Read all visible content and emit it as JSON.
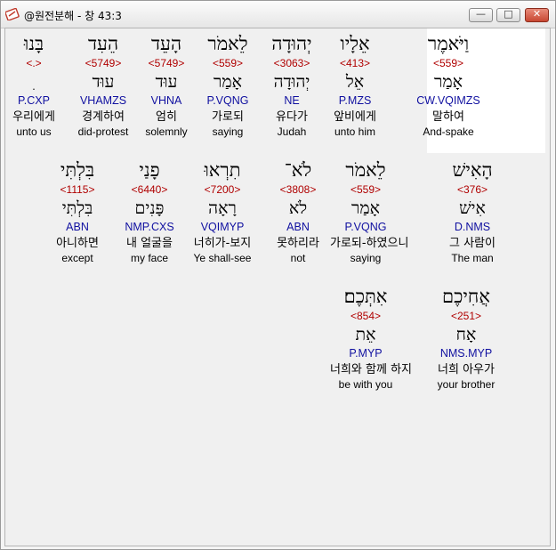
{
  "window": {
    "title": "@원전분해 - 창 43:3",
    "buttons": {
      "minimize": "—",
      "maximize": "□",
      "close": "✕"
    }
  },
  "rows": [
    {
      "words": [
        {
          "hebrew": "וַיֹּאמֶר",
          "strong": "<559>",
          "root": "אָמַר",
          "morph": "CW.VQIMZS",
          "korean": "말하여",
          "english": "And-spake",
          "highlighted": true
        },
        {
          "hebrew": "אֵלָיו",
          "strong": "<413>",
          "root": "אֵל",
          "morph": "P.MZS",
          "korean": "앞비에게",
          "english": "unto him"
        },
        {
          "hebrew": "יְהוּדָה",
          "strong": "<3063>",
          "root": "יְהוּדָה",
          "morph": "NE",
          "korean": "유다가",
          "english": "Judah"
        },
        {
          "hebrew": "לֵאמֹר",
          "strong": "<559>",
          "root": "אָמַר",
          "morph": "P.VQNG",
          "korean": "가로되",
          "english": "saying"
        },
        {
          "hebrew": "הָעֵד",
          "strong": "<5749>",
          "root": "עוּד",
          "morph": "VHNA",
          "korean": "엄히",
          "english": "solemnly"
        },
        {
          "hebrew": "הֵעִד",
          "strong": "<5749>",
          "root": "עוּד",
          "morph": "VHAMZS",
          "korean": "경계하여",
          "english": "did-protest"
        },
        {
          "hebrew": "בָּנוּ",
          "strong": "<.>",
          "root": "ִ",
          "morph": "P.CXP",
          "korean": "우리에게",
          "english": "unto us"
        }
      ]
    },
    {
      "words": [
        {
          "hebrew": "הָאִישׁ",
          "strong": "<376>",
          "root": "אִישׁ",
          "morph": "D.NMS",
          "korean": "그 사람이",
          "english": "The man"
        },
        {
          "hebrew": "לֵאמֹר",
          "strong": "<559>",
          "root": "אָמַר",
          "morph": "P.VQNG",
          "korean": "가로되-하였으니",
          "english": "saying"
        },
        {
          "hebrew": "לֹא־",
          "strong": "<3808>",
          "root": "לֹא",
          "morph": "ABN",
          "korean": "못하리라",
          "english": "not"
        },
        {
          "hebrew": "תִרְאוּ",
          "strong": "<7200>",
          "root": "רָאָה",
          "morph": "VQIMYP",
          "korean": "너히가-보지",
          "english": "Ye shall-see"
        },
        {
          "hebrew": "פָנַי",
          "strong": "<6440>",
          "root": "פָּנִים",
          "morph": "NMP.CXS",
          "korean": "내 얼굴을",
          "english": "my face"
        },
        {
          "hebrew": "בִּלְתִּי",
          "strong": "<1115>",
          "root": "בִּלְתִּי",
          "morph": "ABN",
          "korean": "아니하면",
          "english": "except"
        }
      ]
    },
    {
      "words": [
        {
          "hebrew": "אֲחִיכֶם",
          "strong": "<251>",
          "root": "אָח",
          "morph": "NMS.MYP",
          "korean": "너희 아우가",
          "english": "your brother"
        },
        {
          "hebrew": "אִתְּכֶם׃",
          "strong": "<854>",
          "root": "אֵת",
          "morph": "P.MYP",
          "korean": "너희와 함께 하지",
          "english": "be with you"
        }
      ]
    }
  ]
}
